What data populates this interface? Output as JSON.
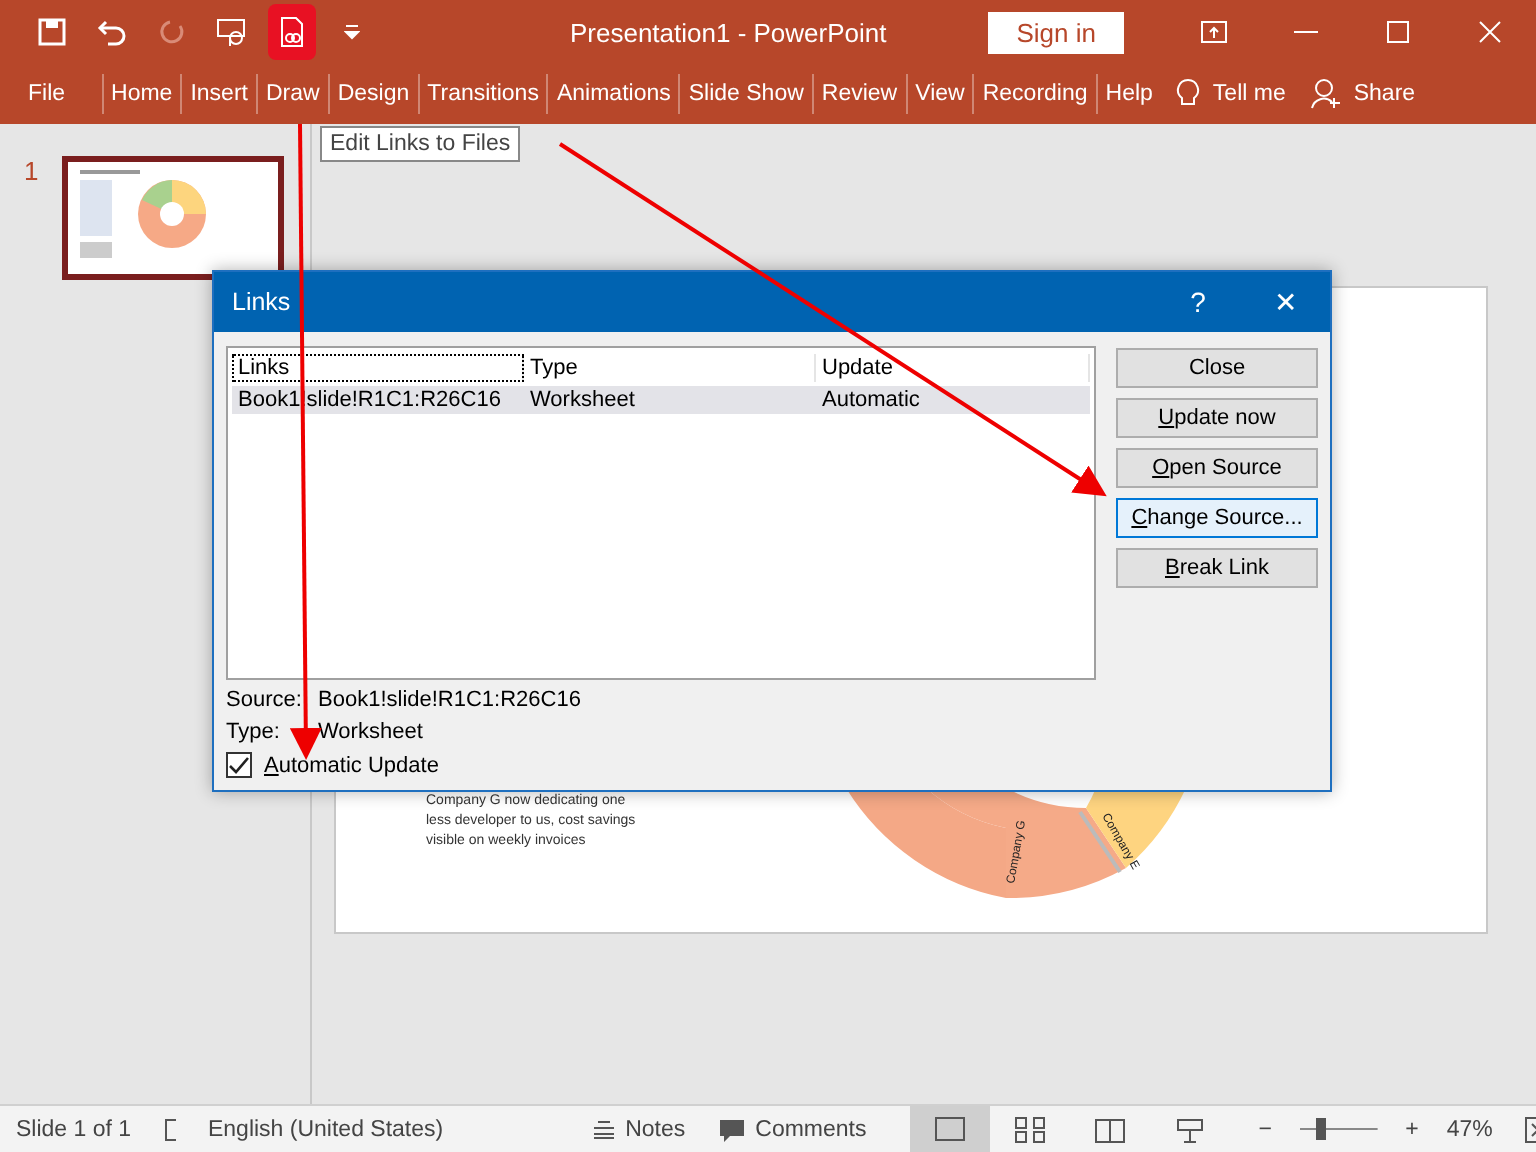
{
  "window": {
    "title": "Presentation1  -  PowerPoint",
    "sign_in": "Sign in"
  },
  "ribbon_tabs": [
    {
      "label": "File"
    },
    {
      "label": "Home"
    },
    {
      "label": "Insert"
    },
    {
      "label": "Draw"
    },
    {
      "label": "Design"
    },
    {
      "label": "Transitions"
    },
    {
      "label": "Animations"
    },
    {
      "label": "Slide Show"
    },
    {
      "label": "Review"
    },
    {
      "label": "View"
    },
    {
      "label": "Recording"
    },
    {
      "label": "Help"
    }
  ],
  "tell_me": "Tell me",
  "share": "Share",
  "tooltip": "Edit Links to Files",
  "slides_panel": {
    "thumbnails": [
      {
        "number": "1",
        "selected": true
      }
    ]
  },
  "slide": {
    "note": "Company G now dedicating one less developer to us, cost savings visible on weekly invoices",
    "chart_labels": [
      "Company G",
      "Company E"
    ]
  },
  "dialog": {
    "title": "Links",
    "help": "?",
    "close": "✕",
    "columns": [
      "Links",
      "Type",
      "Update"
    ],
    "rows": [
      {
        "cells": [
          "Book1!slide!R1C1:R26C16",
          "Worksheet",
          "Automatic"
        ],
        "selected": true
      }
    ],
    "buttons": [
      {
        "label": "Close",
        "underline_first": false,
        "hover": false
      },
      {
        "label": "Update now",
        "underline_first": true,
        "hover": false
      },
      {
        "label": "Open Source",
        "underline_first": true,
        "hover": false
      },
      {
        "label": "Change Source...",
        "underline_first": true,
        "hover": true
      },
      {
        "label": "Break Link",
        "underline_first": true,
        "hover": false
      }
    ],
    "source_label": "Source:",
    "source_value": "Book1!slide!R1C1:R26C16",
    "type_label": "Type:",
    "type_value": "Worksheet",
    "auto_update": {
      "label": "Automatic Update",
      "underline_first": true,
      "checked": true
    }
  },
  "status_bar": {
    "slide": "Slide 1 of 1",
    "language": "English (United States)",
    "notes": "Notes",
    "comments": "Comments",
    "views": [
      {
        "selected": true
      },
      {
        "selected": false
      },
      {
        "selected": false
      },
      {
        "selected": false
      }
    ],
    "zoom": {
      "minus": "−",
      "plus": "+",
      "level": 0.23,
      "reading": "47%"
    }
  }
}
